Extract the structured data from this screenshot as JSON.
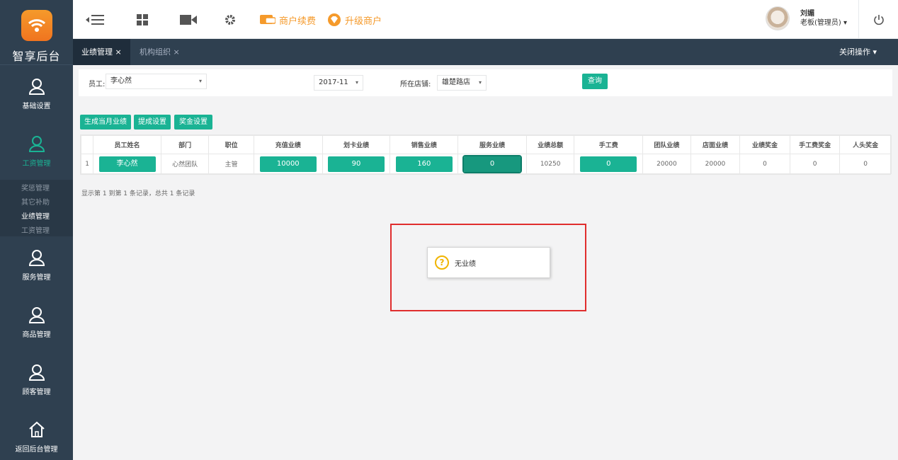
{
  "app": {
    "logo_text": "智享后台"
  },
  "sidebar": {
    "items": [
      {
        "label": "基础设置",
        "icon": "user-icon"
      },
      {
        "label": "工资管理",
        "icon": "user-icon"
      },
      {
        "label": "服务管理",
        "icon": "user-icon"
      },
      {
        "label": "商品管理",
        "icon": "user-icon"
      },
      {
        "label": "顾客管理",
        "icon": "user-icon"
      },
      {
        "label": "返回后台管理",
        "icon": "home-icon"
      }
    ],
    "submenu": [
      "奖惩管理",
      "其它补助",
      "业绩管理",
      "工资管理"
    ]
  },
  "topbar": {
    "renew_label": "商户续费",
    "upgrade_label": "升级商户",
    "user_name": "刘媚",
    "user_role": "老板(管理员)"
  },
  "tabs": [
    {
      "label": "业绩管理 ×"
    },
    {
      "label": "机构组织 ×"
    }
  ],
  "close_ops": "关闭操作",
  "filter": {
    "employee_label": "员工:",
    "employee_value": "李心然",
    "month_value": "2017-11",
    "store_label": "所在店铺:",
    "store_value": "雄楚路店",
    "query_button": "查询"
  },
  "actions": {
    "generate": "生成当月业绩",
    "commission": "提成设置",
    "bonus": "奖金设置"
  },
  "table": {
    "headers": [
      "",
      "员工姓名",
      "部门",
      "职位",
      "充值业绩",
      "划卡业绩",
      "销售业绩",
      "服务业绩",
      "业绩总额",
      "手工费",
      "团队业绩",
      "店面业绩",
      "业绩奖金",
      "手工费奖金",
      "人头奖金"
    ],
    "row": {
      "index": "1",
      "name": "李心然",
      "dept": "心然团队",
      "position": "主管",
      "recharge": "10000",
      "card": "90",
      "sales": "160",
      "service": "0",
      "total": "10250",
      "handfee": "0",
      "team": "20000",
      "store": "20000",
      "perf_bonus": "0",
      "hand_bonus": "0",
      "head_bonus": "0"
    }
  },
  "summary": "显示第 1 到第 1 条记录，总共 1 条记录",
  "dialog": {
    "message": "无业绩"
  },
  "colors": {
    "accent": "#1ab394",
    "sidebar": "#2f4050",
    "orange": "#f59a2b",
    "highlight": "#e02d2d"
  }
}
